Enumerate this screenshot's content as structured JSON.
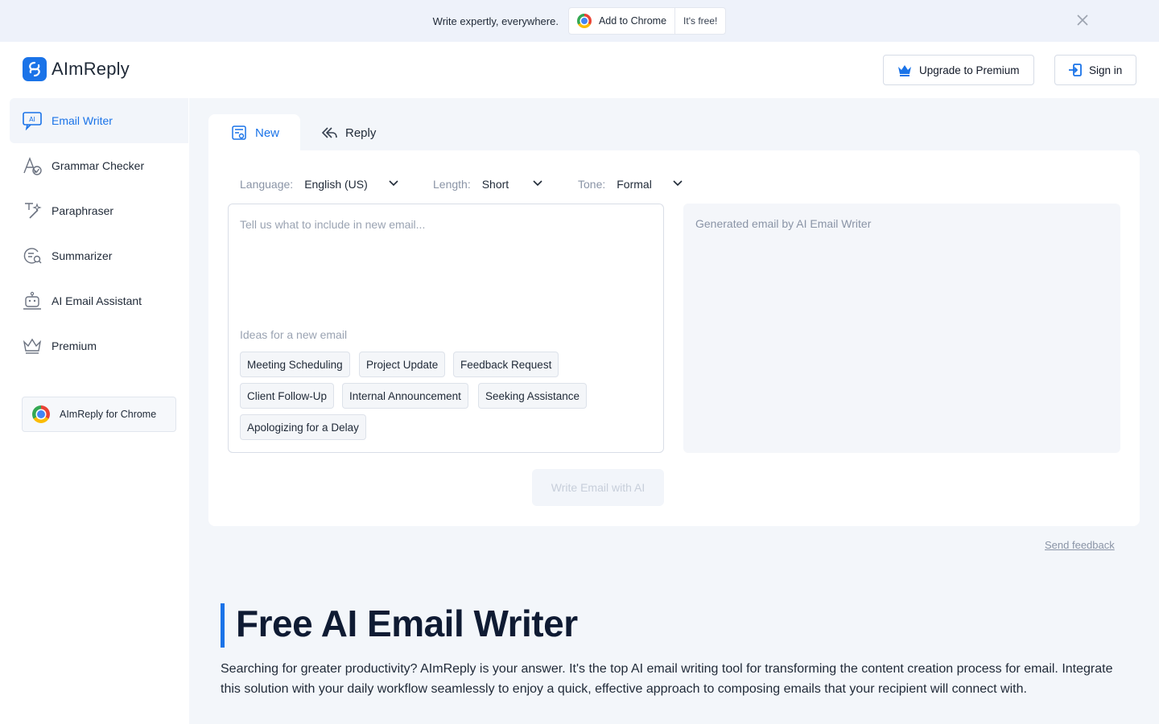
{
  "banner": {
    "text": "Write expertly, everywhere.",
    "add_chrome": "Add to Chrome",
    "free": "It's free!"
  },
  "header": {
    "brand": "AImReply",
    "upgrade": "Upgrade to Premium",
    "signin": "Sign in"
  },
  "sidebar": {
    "items": [
      {
        "label": "Email Writer",
        "icon": "ai-chat-icon",
        "active": true
      },
      {
        "label": "Grammar Checker",
        "icon": "grammar-icon"
      },
      {
        "label": "Paraphraser",
        "icon": "magic-wand-icon"
      },
      {
        "label": "Summarizer",
        "icon": "summarize-icon"
      },
      {
        "label": "AI Email Assistant",
        "icon": "robot-icon"
      },
      {
        "label": "Premium",
        "icon": "crown-icon"
      }
    ],
    "chrome": "AImReply for Chrome"
  },
  "tabs": {
    "new": "New",
    "reply": "Reply"
  },
  "options": {
    "language_label": "Language:",
    "language_value": "English (US)",
    "length_label": "Length:",
    "length_value": "Short",
    "tone_label": "Tone:",
    "tone_value": "Formal"
  },
  "input": {
    "placeholder": "Tell us what to include in new email...",
    "ideas_label": "Ideas for a new email",
    "ideas": [
      "Meeting Scheduling",
      "Project Update",
      "Feedback Request",
      "Client Follow-Up",
      "Internal Announcement",
      "Seeking Assistance",
      "Apologizing for a Delay"
    ]
  },
  "output": {
    "placeholder": "Generated email by AI Email Writer"
  },
  "write_button": "Write Email with AI",
  "feedback": "Send feedback",
  "hero": {
    "title": "Free AI Email Writer",
    "description": "Searching for greater productivity? AImReply is your answer. It's the top AI email writing tool for transforming the content creation process for email. Integrate this solution with your daily workflow seamlessly to enjoy a quick, effective approach to composing emails that your recipient will connect with."
  },
  "colors": {
    "accent": "#1a73e8",
    "title": "#0f1b33",
    "main_bg": "#f3f6fa"
  }
}
